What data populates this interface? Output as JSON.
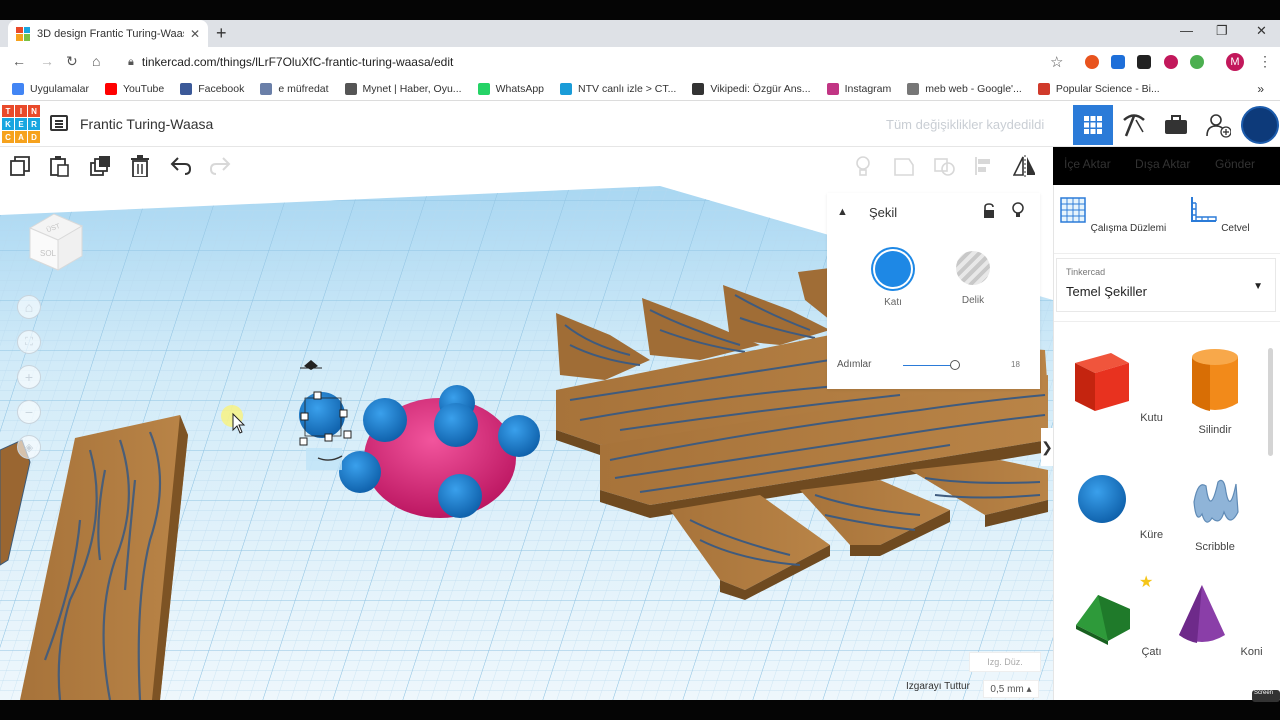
{
  "browser": {
    "tab_title": "3D design Frantic Turing-Waasa",
    "url": "tinkercad.com/things/lLrF7OluXfC-frantic-turing-waasa/edit",
    "bookmarks": [
      {
        "label": "Uygulamalar",
        "color": "#4285f4"
      },
      {
        "label": "YouTube",
        "color": "#ff0000"
      },
      {
        "label": "Facebook",
        "color": "#3b5998"
      },
      {
        "label": "e müfredat",
        "color": "#6a7fa8"
      },
      {
        "label": "Mynet | Haber, Oyu...",
        "color": "#555555"
      },
      {
        "label": "WhatsApp",
        "color": "#25d366"
      },
      {
        "label": "NTV canlı izle > CT...",
        "color": "#1a9cd8"
      },
      {
        "label": "Vikipedi: Özgür Ans...",
        "color": "#333333"
      },
      {
        "label": "Instagram",
        "color": "#c13584"
      },
      {
        "label": "meb web - Google'...",
        "color": "#777777"
      },
      {
        "label": "Popular Science - Bi...",
        "color": "#d03a2b"
      }
    ],
    "profile_initial": "M",
    "profile_color": "#c2185b"
  },
  "app": {
    "logo_letters": [
      "T",
      "I",
      "N",
      "K",
      "E",
      "R",
      "C",
      "A",
      "D"
    ],
    "logo_colors": [
      "#e94a2a",
      "#e94a2a",
      "#e94a2a",
      "#19a6e0",
      "#19a6e0",
      "#19a6e0",
      "#f6a21d",
      "#f6a21d",
      "#f6a21d"
    ],
    "project_name": "Frantic Turing-Waasa",
    "save_status": "Tüm değişiklikler kaydedildi",
    "accent": "#2b7bd8"
  },
  "toolbar": {
    "import_label": "İçe Aktar",
    "export_label": "Dışa Aktar",
    "send_label": "Gönder"
  },
  "viewcube": {
    "face_top": "ÜST",
    "face_left": "SOL"
  },
  "shape_panel": {
    "title": "Şekil",
    "solid_label": "Katı",
    "hole_label": "Delik",
    "solid_color": "#1e88e5",
    "steps_label": "Adımlar",
    "steps_value": "18",
    "steps_fraction": 0.9
  },
  "right_panel": {
    "workplane_label": "Çalışma Düzlemi",
    "ruler_label": "Cetvel",
    "library_small": "Tinkercad",
    "library_name": "Temel Şekiller",
    "shapes": [
      {
        "label": "Kutu",
        "icon": "box-shape-icon",
        "color": "#e8321f"
      },
      {
        "label": "Silindir",
        "icon": "cylinder-shape-icon",
        "color": "#f28a1a"
      },
      {
        "label": "Küre",
        "icon": "sphere-shape-icon",
        "color": "#1c86d8"
      },
      {
        "label": "Scribble",
        "icon": "scribble-shape-icon",
        "color": "#8fb4d8"
      },
      {
        "label": "Çatı",
        "icon": "roof-shape-icon",
        "color": "#2e9a3a"
      },
      {
        "label": "Koni",
        "icon": "cone-shape-icon",
        "color": "#8a3ea8"
      }
    ]
  },
  "workplane": {
    "edit_grid_label": "Izg. Düz.",
    "snap_label": "Izgarayı Tuttur",
    "snap_value": "0,5 mm ▴"
  },
  "taskbar": {
    "recorder_label": "Screen"
  }
}
